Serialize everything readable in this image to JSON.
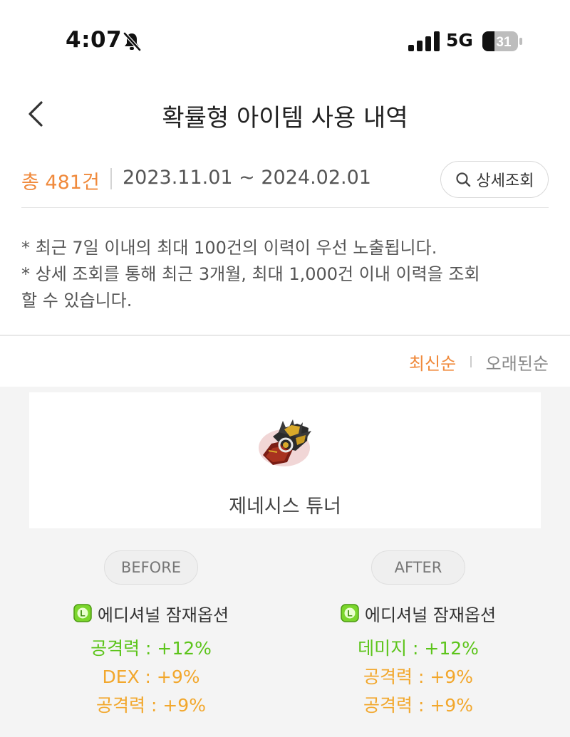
{
  "status_bar": {
    "time": "4:07",
    "network": "5G",
    "battery": "31"
  },
  "header": {
    "title": "확률형 아이템 사용 내역"
  },
  "summary": {
    "total": "총 481건",
    "date_range": "2023.11.01 ~ 2024.02.01",
    "detail_button": "상세조회"
  },
  "notices": [
    "* 최근 7일 이내의 최대 100건의 이력이 우선 노출됩니다.",
    "* 상세 조회를 통해 최근 3개월, 최대 1,000건 이내 이력을 조회",
    "할 수 있습니다."
  ],
  "sort": {
    "newest": "최신순",
    "oldest": "오래된순"
  },
  "item": {
    "name": "제네시스 튜너"
  },
  "before": {
    "label": "BEFORE",
    "option_type": "에디셔널 잠재옵션",
    "stats": [
      "공격력 : +12%",
      "DEX : +9%",
      "공격력 : +9%"
    ]
  },
  "after": {
    "label": "AFTER",
    "option_type": "에디셔널 잠재옵션",
    "stats": [
      "데미지 : +12%",
      "공격력 : +9%",
      "공격력 : +9%"
    ]
  },
  "colors": {
    "accent": "#f08a3c",
    "legendary_stat": "#5cc41a",
    "unique_stat": "#f2a72c",
    "legendary_icon": "#7bd62c"
  },
  "icons": {
    "back": "chevron-left-icon",
    "search": "search-icon",
    "bell": "bell-slash-icon",
    "signal": "signal-icon",
    "battery": "battery-icon",
    "legendary": "legendary-grade-icon"
  }
}
